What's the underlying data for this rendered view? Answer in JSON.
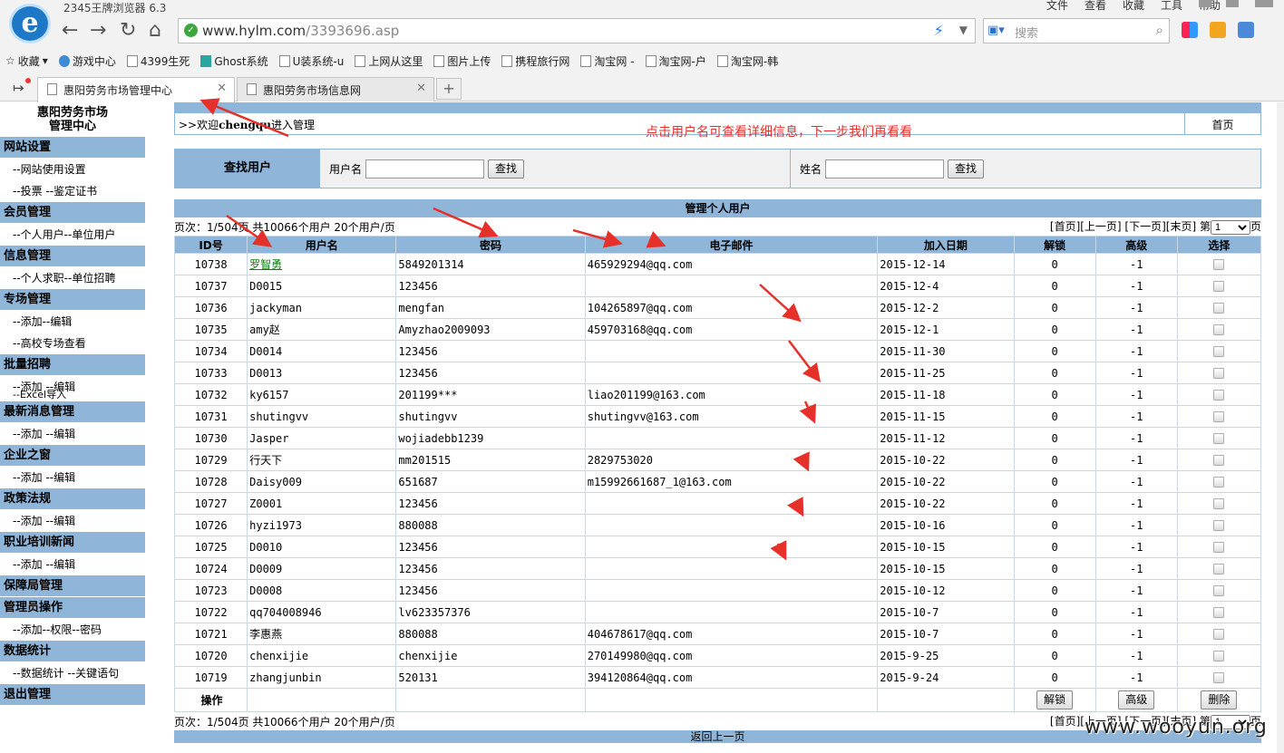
{
  "browser": {
    "app_title": "2345王牌浏览器 6.3",
    "logo_letter": "e",
    "menu": [
      "文件",
      "查看",
      "收藏",
      "工具",
      "帮助"
    ],
    "url_host": "www.hylm.com",
    "url_path": "/3393696.asp",
    "search_placeholder": "搜索",
    "bookmarks": [
      "收藏",
      "游戏中心",
      "4399生死",
      "Ghost系统",
      "U装系统-u",
      "上网从这里",
      "图片上传",
      "携程旅行网",
      "淘宝网 -",
      "淘宝网-户",
      "淘宝网-韩"
    ],
    "tabs": [
      {
        "label": "惠阳劳务市场管理中心",
        "active": true
      },
      {
        "label": "惠阳劳务市场信息网",
        "active": false
      }
    ]
  },
  "sidebar": {
    "title_line1": "惠阳劳务市场",
    "title_line2": "管理中心",
    "sections": [
      {
        "head": "网站设置",
        "items": [
          "--网站使用设置",
          "--投票 --鉴定证书"
        ]
      },
      {
        "head": "会员管理",
        "items": [
          "--个人用户--单位用户"
        ]
      },
      {
        "head": "信息管理",
        "items": [
          "--个人求职--单位招聘"
        ]
      },
      {
        "head": "专场管理",
        "items": [
          "--添加--编辑",
          "--高校专场查看"
        ]
      },
      {
        "head": "批量招聘",
        "items": [
          "--添加 --编辑",
          "--Excel导入"
        ]
      },
      {
        "head": "最新消息管理",
        "items": [
          "--添加 --编辑"
        ]
      },
      {
        "head": "企业之窗",
        "items": [
          "--添加 --编辑"
        ]
      },
      {
        "head": "政策法规",
        "items": [
          "--添加 --编辑"
        ]
      },
      {
        "head": "职业培训新闻",
        "items": [
          "--添加 --编辑"
        ]
      },
      {
        "head": "保障局管理",
        "items": []
      },
      {
        "head": "管理员操作",
        "items": [
          "--添加--权限--密码"
        ]
      },
      {
        "head": "数据统计",
        "items": [
          "--数据统计 --关键语句"
        ]
      },
      {
        "head": "退出管理",
        "items": []
      }
    ]
  },
  "main": {
    "welcome_prefix": ">>欢迎",
    "welcome_user": "chengqu",
    "welcome_suffix": "进入管理",
    "home_link": "首页",
    "annotation": "点击用户名可查看详细信息，下一步我们再看看",
    "search": {
      "label": "查找用户",
      "username_label": "用户名",
      "name_label": "姓名",
      "button": "查找"
    },
    "list_title": "管理个人用户",
    "pager_info": "页次：1/504页 共10066个用户 20个用户/页",
    "pager_links": "[首页][上一页] [下一页][末页] 第",
    "pager_page": "1",
    "pager_suffix": "页",
    "columns": [
      "ID号",
      "用户名",
      "密码",
      "电子邮件",
      "加入日期",
      "解锁",
      "高级",
      "选择"
    ],
    "rows": [
      [
        "10738",
        "罗智勇",
        "5849201314",
        "465929294@qq.com",
        "2015-12-14",
        "0",
        "-1"
      ],
      [
        "10737",
        "D0015",
        "123456",
        "",
        "2015-12-4",
        "0",
        "-1"
      ],
      [
        "10736",
        "jackyman",
        "mengfan",
        "104265897@qq.com",
        "2015-12-2",
        "0",
        "-1"
      ],
      [
        "10735",
        "amy赵",
        "Amyzhao2009093",
        "459703168@qq.com",
        "2015-12-1",
        "0",
        "-1"
      ],
      [
        "10734",
        "D0014",
        "123456",
        "",
        "2015-11-30",
        "0",
        "-1"
      ],
      [
        "10733",
        "D0013",
        "123456",
        "",
        "2015-11-25",
        "0",
        "-1"
      ],
      [
        "10732",
        "ky6157",
        "201199***",
        "liao201199@163.com",
        "2015-11-18",
        "0",
        "-1"
      ],
      [
        "10731",
        "shutingvv",
        "shutingvv",
        "shutingvv@163.com",
        "2015-11-15",
        "0",
        "-1"
      ],
      [
        "10730",
        "Jasper",
        "wojiadebb1239",
        "",
        "2015-11-12",
        "0",
        "-1"
      ],
      [
        "10729",
        "行天下",
        "mm201515",
        "2829753020",
        "2015-10-22",
        "0",
        "-1"
      ],
      [
        "10728",
        "Daisy009",
        "651687",
        "m15992661687_1@163.com",
        "2015-10-22",
        "0",
        "-1"
      ],
      [
        "10727",
        "Z0001",
        "123456",
        "",
        "2015-10-22",
        "0",
        "-1"
      ],
      [
        "10726",
        "hyzi1973",
        "880088",
        "",
        "2015-10-16",
        "0",
        "-1"
      ],
      [
        "10725",
        "D0010",
        "123456",
        "",
        "2015-10-15",
        "0",
        "-1"
      ],
      [
        "10724",
        "D0009",
        "123456",
        "",
        "2015-10-15",
        "0",
        "-1"
      ],
      [
        "10723",
        "D0008",
        "123456",
        "",
        "2015-10-12",
        "0",
        "-1"
      ],
      [
        "10722",
        "qq704008946",
        "lv623357376",
        "",
        "2015-10-7",
        "0",
        "-1"
      ],
      [
        "10721",
        "李惠燕",
        "880088",
        "404678617@qq.com",
        "2015-10-7",
        "0",
        "-1"
      ],
      [
        "10720",
        "chenxijie",
        "chenxijie",
        "270149980@qq.com",
        "2015-9-25",
        "0",
        "-1"
      ],
      [
        "10719",
        "zhangjunbin",
        "520131",
        "394120864@qq.com",
        "2015-9-24",
        "0",
        "-1"
      ]
    ],
    "ops_label": "操作",
    "ops_buttons": [
      "解锁",
      "高级",
      "删除"
    ],
    "back_link": "返回上一页"
  },
  "watermark": "www.wooyun.org",
  "colors": {
    "header_blue": "#8fb6d9",
    "annotation_red": "#e5312a",
    "link_green": "#108010"
  }
}
